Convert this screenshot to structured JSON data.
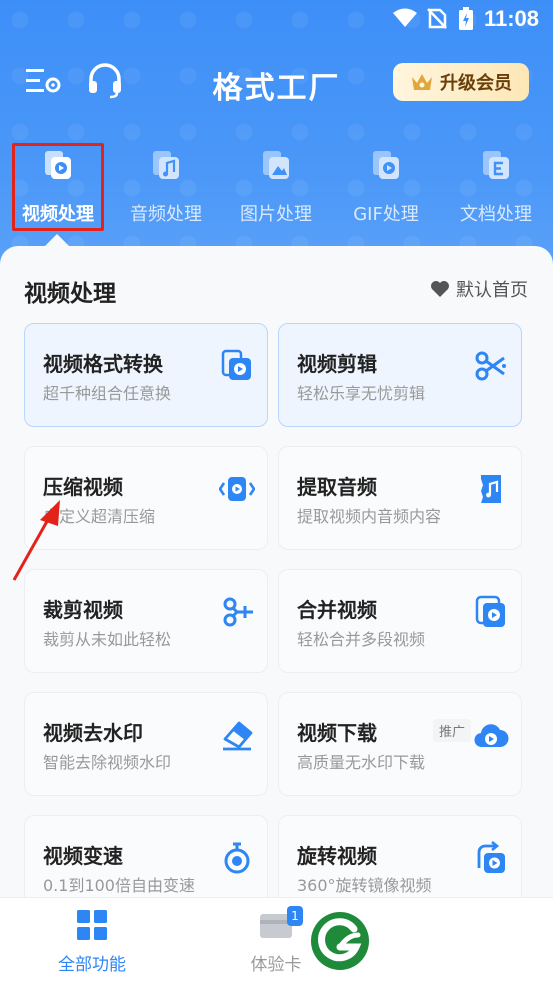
{
  "status_bar": {
    "time": "11:08"
  },
  "header": {
    "title": "格式工厂",
    "vip_label": "升级会员"
  },
  "tabs": [
    {
      "label": "视频处理",
      "icon": "video-file-icon",
      "active": true
    },
    {
      "label": "音频处理",
      "icon": "audio-file-icon",
      "active": false
    },
    {
      "label": "图片处理",
      "icon": "image-file-icon",
      "active": false
    },
    {
      "label": "GIF处理",
      "icon": "gif-file-icon",
      "active": false
    },
    {
      "label": "文档处理",
      "icon": "document-file-icon",
      "active": false
    }
  ],
  "section": {
    "title": "视频处理",
    "default_home_label": "默认首页"
  },
  "cards": [
    {
      "title": "视频格式转换",
      "subtitle": "超千种组合任意换",
      "icon": "video-convert-icon",
      "highlighted": true
    },
    {
      "title": "视频剪辑",
      "subtitle": "轻松乐享无忧剪辑",
      "icon": "scissors-icon",
      "highlighted": true
    },
    {
      "title": "压缩视频",
      "subtitle": "自定义超清压缩",
      "icon": "compress-icon"
    },
    {
      "title": "提取音频",
      "subtitle": "提取视频内音频内容",
      "icon": "music-file-icon"
    },
    {
      "title": "裁剪视频",
      "subtitle": "裁剪从未如此轻松",
      "icon": "crop-scissors-icon"
    },
    {
      "title": "合并视频",
      "subtitle": "轻松合并多段视频",
      "icon": "merge-video-icon"
    },
    {
      "title": "视频去水印",
      "subtitle": "智能去除视频水印",
      "icon": "eraser-icon"
    },
    {
      "title": "视频下载",
      "subtitle": "高质量无水印下载",
      "icon": "cloud-play-icon",
      "badge": "推广"
    },
    {
      "title": "视频变速",
      "subtitle": "0.1到100倍自由变速",
      "icon": "stopwatch-icon"
    },
    {
      "title": "旋转视频",
      "subtitle": "360°旋转镜像视频",
      "icon": "rotate-video-icon"
    }
  ],
  "bottom_nav": [
    {
      "label": "全部功能",
      "icon": "grid-icon",
      "active": true
    },
    {
      "label": "体验卡",
      "icon": "card-icon",
      "badge": "1",
      "active": false
    }
  ],
  "colors": {
    "accent": "#2e86f5",
    "header_bg": "#3d8ff8",
    "highlight_border": "#e2231a"
  }
}
